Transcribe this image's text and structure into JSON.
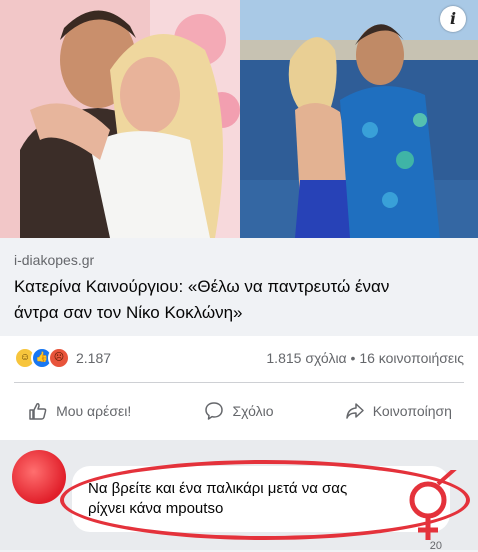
{
  "link_preview": {
    "domain": "i-diakopes.gr",
    "headline_line1": "Κατερίνα Καινούργιου: «Θέλω να παντρευτώ έναν",
    "headline_line2": "άντρα σαν τον Νίκο Κοκλώνη»",
    "info_icon_label": "i"
  },
  "stats": {
    "reactions": [
      "haha-icon",
      "like-icon",
      "angry-icon"
    ],
    "reaction_count": "2.187",
    "comments_shares": "1.815 σχόλια • 16 κοινοποιήσεις"
  },
  "actions": {
    "like": "Μου αρέσει!",
    "comment": "Σχόλιο",
    "share": "Κοινοποίηση"
  },
  "comment": {
    "line1": "Να βρείτε και ένα παλικάρι μετά να σας",
    "line2": "ρίχνει κάνα mpoutso",
    "reply_count": "20"
  },
  "colors": {
    "accent_red": "#e4323b",
    "facebook_blue": "#1877f2"
  }
}
